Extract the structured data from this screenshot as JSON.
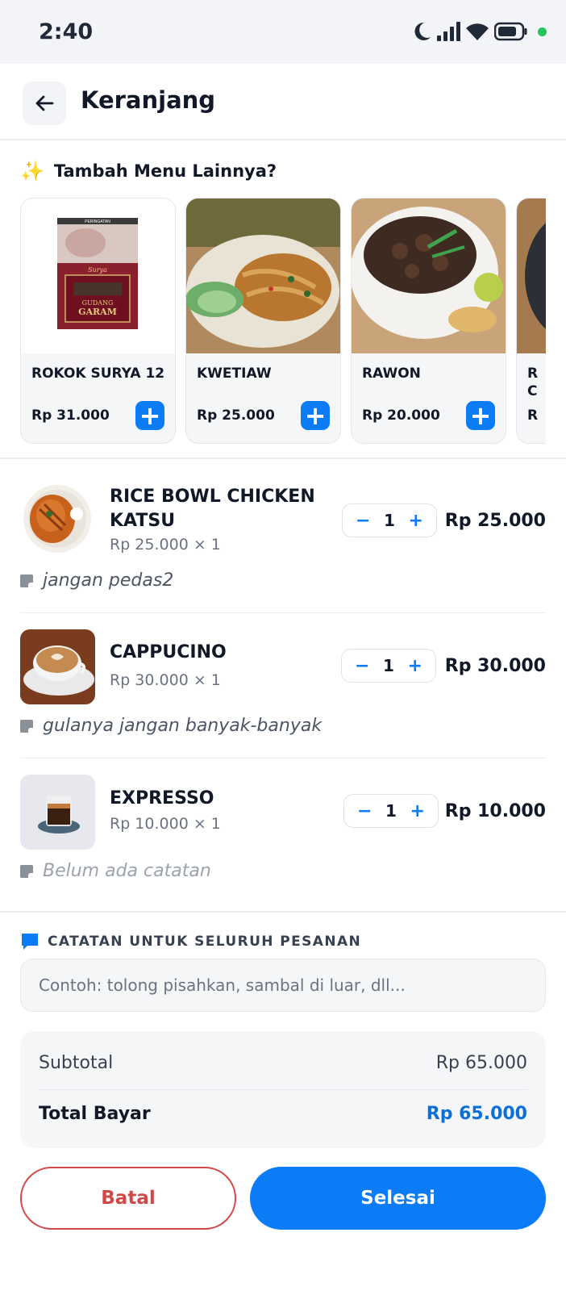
{
  "status_bar": {
    "time": "2:40"
  },
  "header": {
    "title": "Keranjang"
  },
  "suggestions": {
    "title": "Tambah Menu Lainnya?",
    "items": [
      {
        "name": "ROKOK SURYA 12",
        "price": "Rp 31.000"
      },
      {
        "name": "KWETIAW",
        "price": "Rp 25.000"
      },
      {
        "name": "RAWON",
        "price": "Rp 20.000"
      },
      {
        "name": "R\nC",
        "price": "R"
      }
    ],
    "pack_text": {
      "warning": "PERINGATAN",
      "brand": "Surya",
      "maker": "GUDANG",
      "maker2": "GARAM"
    }
  },
  "cart": {
    "items": [
      {
        "name": "RICE BOWL CHICKEN KATSU",
        "unit": "Rp 25.000 × 1",
        "qty": "1",
        "total": "Rp 25.000",
        "note": "jangan pedas2"
      },
      {
        "name": "CAPPUCINO",
        "unit": "Rp 30.000 × 1",
        "qty": "1",
        "total": "Rp 30.000",
        "note": "gulanya jangan banyak-banyak"
      },
      {
        "name": "EXPRESSO",
        "unit": "Rp 10.000 × 1",
        "qty": "1",
        "total": "Rp 10.000",
        "note": "Belum ada catatan"
      }
    ],
    "minus_label": "−",
    "plus_label": "+"
  },
  "order_note": {
    "title": "CATATAN UNTUK SELURUH PESANAN",
    "placeholder": "Contoh: tolong pisahkan, sambal di luar, dll..."
  },
  "summary": {
    "subtotal_label": "Subtotal",
    "subtotal_value": "Rp 65.000",
    "total_label": "Total Bayar",
    "total_value": "Rp 65.000"
  },
  "actions": {
    "cancel": "Batal",
    "done": "Selesai"
  },
  "colors": {
    "accent": "#0b7cf5",
    "danger": "#d14848"
  }
}
